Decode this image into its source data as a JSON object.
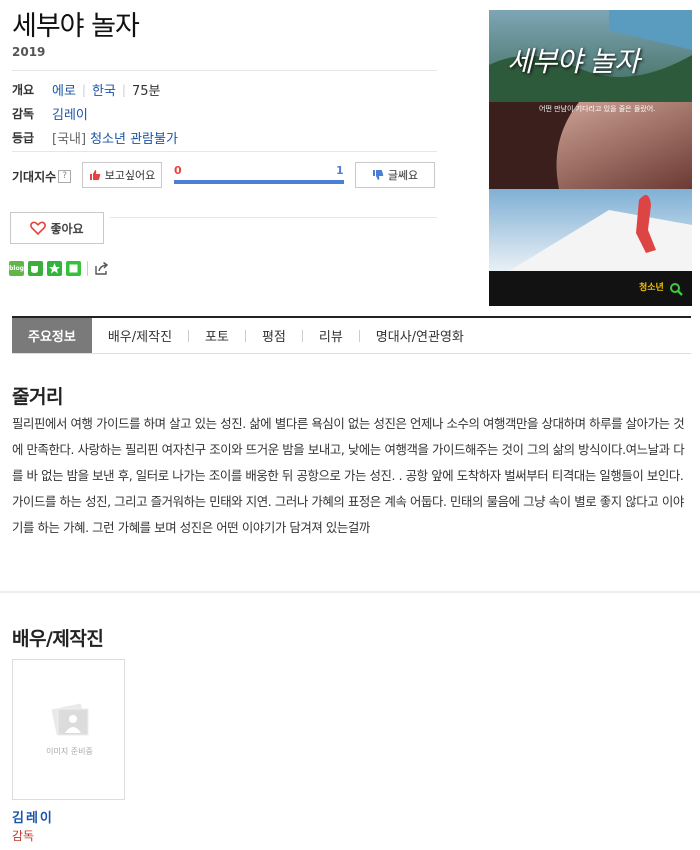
{
  "movie": {
    "title": "세부야 놀자",
    "year": "2019"
  },
  "info": {
    "overview_label": "개요",
    "genre": "에로",
    "country": "한국",
    "runtime": "75분",
    "director_label": "감독",
    "director": "김레이",
    "rating_label": "등급",
    "rating_region": "[국내]",
    "rating": "청소년 관람불가"
  },
  "expectation": {
    "label": "기대지수",
    "help_icon": "?",
    "want_label": "보고싶어요",
    "want_count": "0",
    "meh_count": "1",
    "meh_label": "글쎄요",
    "meh_fraction": 1.0
  },
  "like": {
    "label": "좋아요"
  },
  "social": {
    "icons": [
      "blog-icon",
      "cafe-icon",
      "bookmark-star-icon",
      "green-square-icon",
      "share-icon"
    ],
    "blog_text": "blog"
  },
  "poster": {
    "title_text": "세부야 놀자",
    "tagline": "어떤 만남이 기다리고 있을 줄은 몰랐어.",
    "age_badge": "청소년"
  },
  "tabs": [
    {
      "label": "주요정보",
      "active": true
    },
    {
      "label": "배우/제작진",
      "active": false
    },
    {
      "label": "포토",
      "active": false
    },
    {
      "label": "평점",
      "active": false
    },
    {
      "label": "리뷰",
      "active": false
    },
    {
      "label": "명대사/연관영화",
      "active": false
    }
  ],
  "synopsis": {
    "heading": "줄거리",
    "text": "필리핀에서 여행 가이드를 하며 살고 있는 성진. 삶에 별다른 욕심이 없는 성진은 언제나 소수의 여행객만을 상대하며 하루를 살아가는 것에 만족한다. 사랑하는 필리핀 여자친구 조이와 뜨거운 밤을 보내고, 낮에는 여행객을 가이드해주는 것이 그의 삶의 방식이다.여느날과 다를 바 없는 밤을 보낸 후, 일터로 나가는 조이를 배웅한 뒤 공항으로 가는 성진. . 공항 앞에 도착하자 벌써부터 티격대는 일행들이 보인다. 가이드를 하는 성진, 그리고 즐거워하는 민태와 지연. 그러나 가혜의 표정은 계속 어둡다. 민태의 물음에 그냥 속이 별로 좋지 않다고 이야기를 하는 가혜. 그런 가혜를 보며 성진은 어떤 이야기가 담겨져 있는걸까"
  },
  "cast": {
    "heading": "배우/제작진",
    "members": [
      {
        "name": "김레이",
        "role": "감독",
        "photo_placeholder": "이미지 준비중"
      }
    ]
  },
  "colors": {
    "accent_blue": "#1a55a8",
    "red": "#e8423c",
    "bar_blue": "#4a7fd4",
    "tab_active": "#7a7a7a"
  }
}
